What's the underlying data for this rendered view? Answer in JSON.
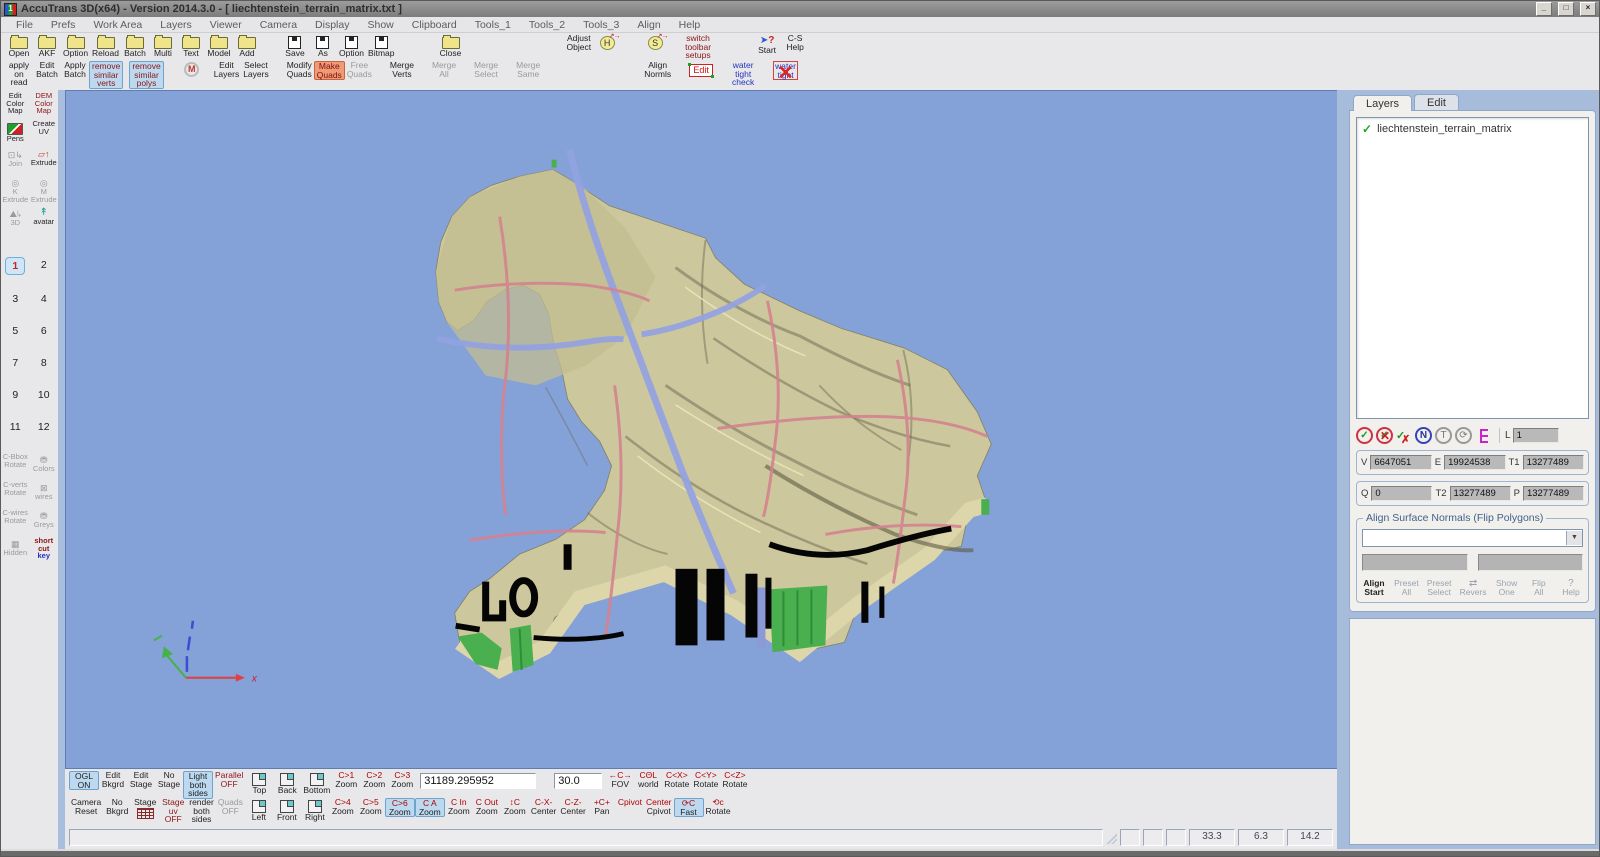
{
  "window": {
    "title": "AccuTrans 3D(x64) - Version 2014.3.0 - [ liechtenstein_terrain_matrix.txt ]",
    "minimize": "_",
    "restore": "□",
    "close": "×"
  },
  "menu": [
    "File",
    "Prefs",
    "Work Area",
    "Layers",
    "Viewer",
    "Camera",
    "Display",
    "Show",
    "Clipboard",
    "Tools_1",
    "Tools_2",
    "Tools_3",
    "Align",
    "Help"
  ],
  "tb1": [
    "Open",
    "AKF",
    "Option",
    "Reload",
    "Batch",
    "Multi",
    "Text",
    "Model",
    "Add",
    "Save",
    "As",
    "Option",
    "Bitmap",
    "Close",
    "Adjust\nObject",
    "H",
    "S",
    "switch\ntoolbar\nsetups",
    "Start",
    "C-S\nHelp"
  ],
  "tb2": [
    "apply\non\nread",
    "Edit\nBatch",
    "Apply\nBatch",
    "remove\nsimilar\nverts",
    "remove\nsimilar\npolys",
    "M",
    "Edit\nLayers",
    "Select\nLayers",
    "Modify\nQuads",
    "Make\nQuads",
    "Free\nQuads",
    "Merge\nVerts",
    "Merge\nAll",
    "Merge\nSelect",
    "Merge\nSame",
    "Align\nNormls",
    "Edit",
    "water\ntight\ncheck",
    "water\ntight"
  ],
  "side": {
    "items": [
      "Edit\nColor\nMap",
      "DEM\nColor\nMap",
      "Pens",
      "Create\nUV",
      "Join",
      "Extrude",
      "K\nExtrude",
      "M\nExtrude",
      "3D",
      "avatar"
    ],
    "numbers": [
      "1",
      "2",
      "3",
      "4",
      "5",
      "6",
      "7",
      "8",
      "9",
      "10",
      "11",
      "12"
    ],
    "lower": [
      "C-Bbox\nRotate",
      "Colors",
      "C-verts\nRotate",
      "wires",
      "C-wires\nRotate",
      "Greys",
      "Hidden",
      "short\ncut",
      "key"
    ]
  },
  "layers": {
    "tabs": [
      "Layers",
      "Edit"
    ],
    "item": "liechtenstein_terrain_matrix",
    "l": "L",
    "lval": "1",
    "rows": [
      {
        "k": "V",
        "v": "6647051"
      },
      {
        "k": "E",
        "v": "19924538"
      },
      {
        "k": "T1",
        "v": "13277489"
      },
      {
        "k": "Q",
        "v": "0"
      },
      {
        "k": "T2",
        "v": "13277489"
      },
      {
        "k": "P",
        "v": "13277489"
      }
    ],
    "align": {
      "title": "Align Surface Normals (Flip Polygons)",
      "buttons": [
        "Align\nStart",
        "Preset\nAll",
        "Preset\nSelect",
        "Revers",
        "Show\nOne",
        "Flip\nAll",
        "Help"
      ]
    }
  },
  "bb1": [
    "OGL\nON",
    "Edit\nBkgrd",
    "Edit\nStage",
    "No\nStage",
    "Light\nboth\nsides",
    "Parallel\nOFF",
    "Top",
    "Back",
    "Bottom",
    "C>1\nZoom",
    "C>2\nZoom",
    "C>3\nZoom",
    "←C→\nFOV",
    "CΘL\nworld",
    "C<X>\nRotate",
    "C<Y>\nRotate",
    "C<Z>\nRotate"
  ],
  "bb_fov": "31189.295952",
  "bb_angle": "30.0",
  "bb2": [
    "Camera\nReset",
    "No\nBkgrd",
    "Stage",
    "Stage\nuv\nOFF",
    "render\nboth\nsides",
    "Quads\nOFF",
    "Left",
    "Front",
    "Right",
    "C>4\nZoom",
    "C>5\nZoom",
    "C>6\nZoom",
    "C A\nZoom",
    "C In\nZoom",
    "C Out\nZoom",
    "↕C\nZoom",
    "C-X-\nCenter",
    "C-Z-\nCenter",
    "+C+\nPan",
    "Cpivot",
    "Center\nCpivot",
    "⟳C\nFast",
    "⟲c\nRotate"
  ],
  "status": [
    "33.3",
    "6.3",
    "14.2"
  ],
  "colors": {
    "viewport_bg": "#84a1d8",
    "terrain": "#cdc79d",
    "river": "#93a2e2",
    "grid_pink": "#d4838f",
    "green": "#4ab04f",
    "highlight": "#bcd9ef"
  }
}
